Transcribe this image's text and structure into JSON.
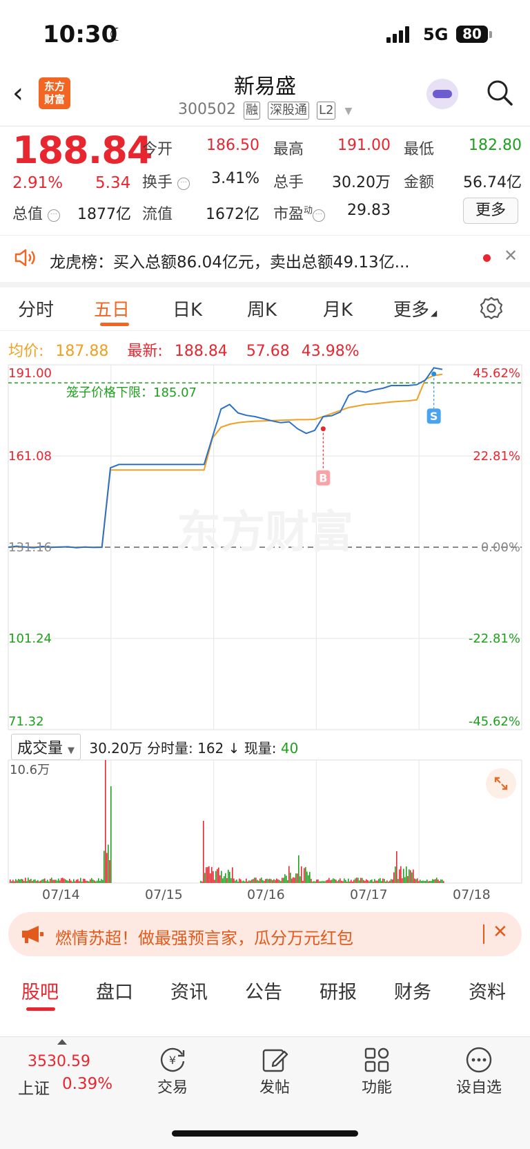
{
  "status": {
    "time": "10:30",
    "network": "5G",
    "battery": "80"
  },
  "header": {
    "logo_text": "东方\n财富",
    "stock_name": "新易盛",
    "stock_code": "300502",
    "tags": [
      "融",
      "深股通",
      "L2"
    ]
  },
  "quote": {
    "price": "188.84",
    "change_pct": "2.91%",
    "change_amt": "5.34",
    "fields": [
      {
        "label": "今开",
        "value": "186.50"
      },
      {
        "label": "最高",
        "value": "191.00"
      },
      {
        "label": "最低",
        "value": "182.80"
      },
      {
        "label": "换手",
        "value": "3.41%"
      },
      {
        "label": "总手",
        "value": "30.20万"
      },
      {
        "label": "金额",
        "value": "56.74亿"
      },
      {
        "label": "总值",
        "value": "1877亿"
      },
      {
        "label": "流值",
        "value": "1672亿"
      },
      {
        "label": "市盈",
        "value": "29.83"
      }
    ],
    "pe_superscript": "动",
    "more_label": "更多"
  },
  "news": {
    "text": "龙虎榜：买入总额86.04亿元，卖出总额49.13亿..."
  },
  "chart_tabs": [
    "分时",
    "五日",
    "日K",
    "周K",
    "月K",
    "更多"
  ],
  "chart_info": {
    "avg_label": "均价:",
    "avg": "187.88",
    "latest_label": "最新:",
    "latest": "188.84",
    "change": "57.68",
    "change_pct": "43.98%"
  },
  "chart_data": {
    "type": "line",
    "x_dates": [
      "07/14",
      "07/15",
      "07/16",
      "07/17",
      "07/18"
    ],
    "y_left_ticks": [
      "191.00",
      "161.08",
      "131.16",
      "101.24",
      "71.32"
    ],
    "y_right_ticks": [
      "45.62%",
      "22.81%",
      "0.00%",
      "-22.81%",
      "-45.62%"
    ],
    "ylim": [
      71.32,
      191.0
    ],
    "annotation": "笼子价格下限：185.07",
    "cage_lower": 185.07,
    "markers": [
      {
        "label": "B",
        "value": 170.0
      },
      {
        "label": "S",
        "value": 188.0
      }
    ],
    "series": [
      {
        "name": "price",
        "color": "#2a6fc9",
        "values": [
          131.16,
          131.5,
          131.2,
          131.0,
          131.4,
          131.1,
          131.2,
          131.3,
          131.0,
          131.2,
          131.1,
          131.16,
          157.2,
          158.3,
          158.3,
          158.3,
          158.3,
          158.3,
          158.3,
          158.3,
          158.3,
          158.3,
          158.3,
          158.3,
          167.4,
          176.5,
          178.0,
          175.2,
          174.4,
          174.0,
          173.3,
          172.6,
          172.0,
          172.3,
          170.0,
          168.5,
          169.5,
          174.0,
          174.3,
          175.5,
          181.0,
          182.5,
          182.0,
          182.8,
          183.3,
          184.2,
          184.2,
          184.2,
          184.5,
          186.0,
          190.0,
          189.5
        ]
      },
      {
        "name": "average",
        "color": "#f0a020",
        "values": [
          131.16,
          131.3,
          131.2,
          131.2,
          131.2,
          131.2,
          131.2,
          131.2,
          131.1,
          131.2,
          131.1,
          131.1,
          156.5,
          156.5,
          156.5,
          156.5,
          156.5,
          156.5,
          156.5,
          156.5,
          156.5,
          156.5,
          156.5,
          156.5,
          167.0,
          170.5,
          171.5,
          172.0,
          172.3,
          172.5,
          172.6,
          172.7,
          172.8,
          172.9,
          173.0,
          173.0,
          173.1,
          174.0,
          175.0,
          176.0,
          177.0,
          177.5,
          178.0,
          178.2,
          178.5,
          178.8,
          179.0,
          179.2,
          179.5,
          186.2,
          187.5,
          187.88
        ]
      }
    ]
  },
  "volume": {
    "dropdown_label": "成交量",
    "total": "30.20万",
    "minute_label": "分时量:",
    "minute": "162",
    "current_label": "现量:",
    "current": "40",
    "max_label": "10.6万"
  },
  "promo": {
    "text": "燃情苏超！做最强预言家，瓜分万元红包"
  },
  "bottom_tabs": [
    "股吧",
    "盘口",
    "资讯",
    "公告",
    "研报",
    "财务",
    "资料"
  ],
  "tabbar": {
    "index_value": "3530.59",
    "index_name": "上证",
    "index_pct": "0.39%",
    "items": [
      {
        "label": "交易",
        "icon": "trade-icon"
      },
      {
        "label": "发帖",
        "icon": "post-icon"
      },
      {
        "label": "功能",
        "icon": "grid-icon"
      },
      {
        "label": "设自选",
        "icon": "more-icon"
      }
    ]
  },
  "colors": {
    "up": "#e8262f",
    "down": "#1ea01e",
    "price_line": "#2a6fc9",
    "avg_line": "#f0a020",
    "accent": "#f26522"
  }
}
